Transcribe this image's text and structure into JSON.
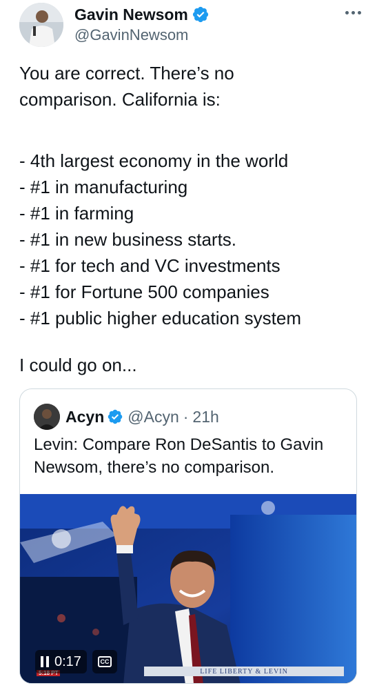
{
  "author": {
    "name": "Gavin Newsom",
    "handle": "@GavinNewsom",
    "verified_icon": "verified-badge-icon"
  },
  "tweet": {
    "intro_lines": [
      "You are correct. There’s no",
      "comparison. California is:"
    ],
    "list_items": [
      "- 4th largest economy in the world",
      "- #1 in manufacturing",
      "- #1 in farming",
      "- #1 in new business starts.",
      "- #1 for tech and VC investments",
      "- #1 for Fortune 500 companies",
      "- #1 public higher education system"
    ],
    "closing": "I could go on..."
  },
  "quote": {
    "name": "Acyn",
    "handle": "@Acyn",
    "separator": "·",
    "time": "21h",
    "text_lines": [
      "Levin: Compare Ron DeSantis to Gavin",
      "Newsom, there’s no comparison."
    ],
    "video": {
      "time": "0:17",
      "cc_label": "CC",
      "ticker_text": "LIFE LIBERTY & LEVIN",
      "clock_chip": "5:18 PT"
    }
  },
  "colors": {
    "text": "#0f1419",
    "muted": "#536471",
    "verified_blue": "#1d9bf0",
    "border": "#cfd9de"
  }
}
